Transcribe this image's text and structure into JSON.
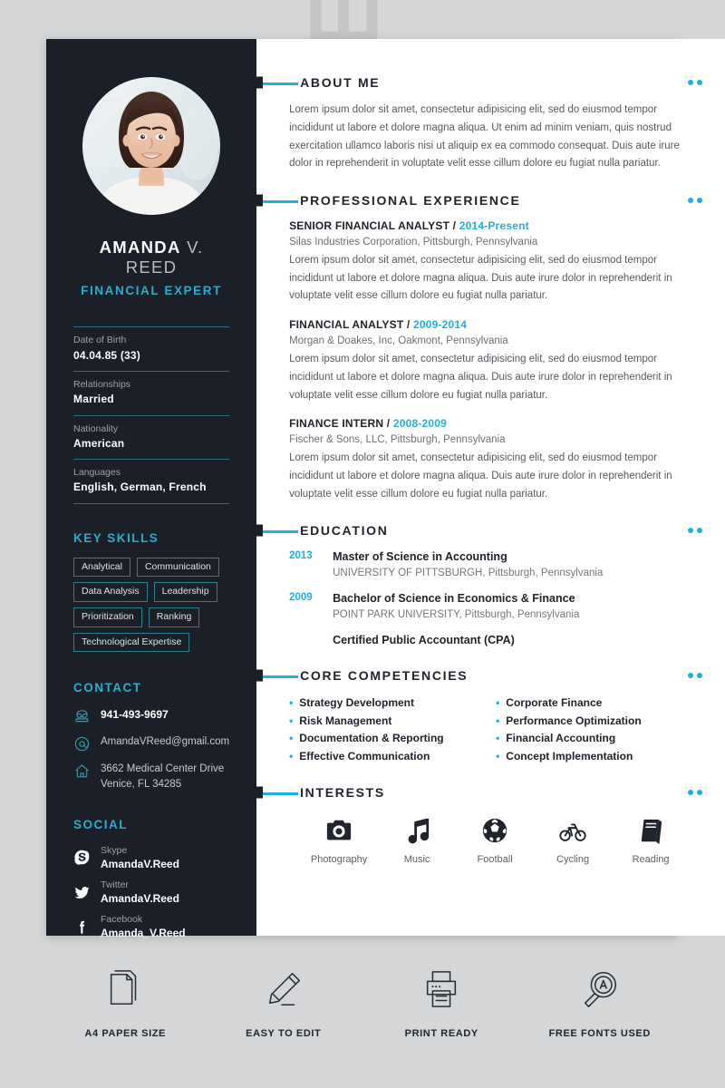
{
  "background": {
    "watermark_text": "FINANCIAL EXPERT",
    "page_bg": "#d4d6d8",
    "accent": "#21aee0",
    "sidebar_bg": "#1a1f28"
  },
  "sidebar": {
    "photo_alt": "profile-photo",
    "name_first": "AMANDA",
    "name_last": " V. REED",
    "role": "FINANCIAL EXPERT",
    "details": [
      {
        "label": "Date of Birth",
        "value": "04.04.85 (33)"
      },
      {
        "label": "Relationships",
        "value": "Married"
      },
      {
        "label": "Nationality",
        "value": "American"
      },
      {
        "label": "Languages",
        "value": "English, German, French"
      }
    ],
    "skills_heading": "KEY SKILLS",
    "skills": [
      "Analytical",
      "Communication",
      "Data Analysis",
      "Leadership",
      "Prioritization",
      "Ranking",
      "Technological Expertise"
    ],
    "contact_heading": "CONTACT",
    "contact": [
      {
        "icon": "phone-icon",
        "value": "941-493-9697",
        "strong": true
      },
      {
        "icon": "at-email-icon",
        "value": "AmandaVReed@gmail.com",
        "strong": false
      },
      {
        "icon": "home-icon",
        "value": "3662 Medical Center Drive",
        "value2": "Venice, FL 34285",
        "strong": false
      }
    ],
    "social_heading": "SOCIAL",
    "social": [
      {
        "icon": "skype-icon",
        "network": "Skype",
        "handle": "AmandaV.Reed"
      },
      {
        "icon": "twitter-icon",
        "network": "Twitter",
        "handle": "AmandaV.Reed"
      },
      {
        "icon": "facebook-icon",
        "network": "Facebook",
        "handle": "Amanda_V.Reed"
      }
    ]
  },
  "main": {
    "about": {
      "title": "ABOUT ME",
      "text": "Lorem ipsum dolor sit amet, consectetur adipisicing elit, sed do eiusmod tempor incididunt ut labore et dolore magna aliqua. Ut enim ad minim veniam, quis nostrud exercitation ullamco laboris nisi ut aliquip ex ea commodo consequat. Duis aute irure dolor in reprehenderit in voluptate velit esse cillum dolore eu fugiat nulla pariatur."
    },
    "experience": {
      "title": "PROFESSIONAL EXPERIENCE",
      "jobs": [
        {
          "role": "SENIOR FINANCIAL ANALYST",
          "separator": " / ",
          "years": "2014-Present",
          "company": "Silas Industries Corporation, Pittsburgh, Pennsylvania",
          "description": "Lorem ipsum dolor sit amet, consectetur adipisicing elit, sed do eiusmod tempor incididunt ut labore et dolore magna aliqua. Duis aute irure dolor in reprehenderit in voluptate velit esse cillum dolore eu fugiat nulla pariatur."
        },
        {
          "role": "FINANCIAL ANALYST",
          "separator": " / ",
          "years": "2009-2014",
          "company": "Morgan & Doakes, Inc, Oakmont, Pennsylvania",
          "description": "Lorem ipsum dolor sit amet, consectetur adipisicing elit, sed do eiusmod tempor incididunt ut labore et dolore magna aliqua. Duis aute irure dolor in reprehenderit in voluptate velit esse cillum dolore eu fugiat nulla pariatur."
        },
        {
          "role": "FINANCE INTERN",
          "separator": " / ",
          "years": "2008-2009",
          "company": "Fischer & Sons, LLC, Pittsburgh, Pennsylvania",
          "description": "Lorem ipsum dolor sit amet, consectetur adipisicing elit, sed do eiusmod tempor incididunt ut labore et dolore magna aliqua. Duis aute irure dolor in reprehenderit in voluptate velit esse cillum dolore eu fugiat nulla pariatur."
        }
      ]
    },
    "education": {
      "title": "EDUCATION",
      "entries": [
        {
          "year": "2013",
          "degree": "Master of Science in Accounting",
          "school": "UNIVERSITY OF PITTSBURGH, Pittsburgh, Pennsylvania"
        },
        {
          "year": "2009",
          "degree": "Bachelor of Science in Economics & Finance",
          "school": "POINT PARK UNIVERSITY, Pittsburgh, Pennsylvania"
        },
        {
          "year": "",
          "degree": "Certified Public Accountant (CPA)",
          "school": ""
        }
      ]
    },
    "competencies": {
      "title": "CORE COMPETENCIES",
      "left": [
        "Strategy Development",
        "Risk Management",
        "Documentation & Reporting",
        "Effective Communication"
      ],
      "right": [
        "Corporate Finance",
        "Performance Optimization",
        "Financial Accounting",
        "Concept Implementation"
      ]
    },
    "interests": {
      "title": "INTERESTS",
      "items": [
        {
          "icon": "camera-icon",
          "label": "Photography"
        },
        {
          "icon": "music-note-icon",
          "label": "Music"
        },
        {
          "icon": "soccer-ball-icon",
          "label": "Football"
        },
        {
          "icon": "bicycle-icon",
          "label": "Cycling"
        },
        {
          "icon": "book-icon",
          "label": "Reading"
        }
      ]
    }
  },
  "features": [
    {
      "icon": "paper-stack-icon",
      "label": "A4 PAPER SIZE"
    },
    {
      "icon": "pencil-icon",
      "label": "EASY TO EDIT"
    },
    {
      "icon": "printer-icon",
      "label": "PRINT READY"
    },
    {
      "icon": "magnifier-a-icon",
      "label": "FREE FONTS USED"
    }
  ]
}
